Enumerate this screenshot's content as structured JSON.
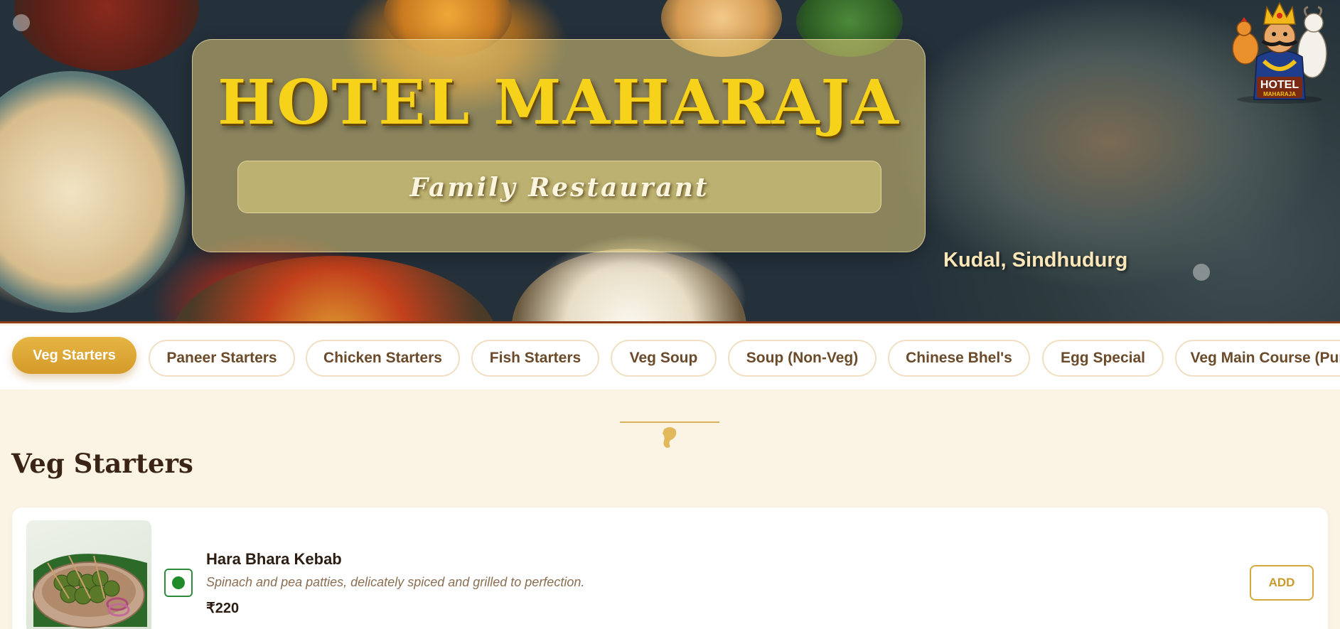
{
  "header": {
    "hotel_name": "HOTEL MAHARAJA",
    "tagline": "Family Restaurant",
    "location": "Kudal, Sindhudurg",
    "logo_text_main": "HOTEL",
    "logo_text_sub": "MAHARAJA"
  },
  "categories": [
    {
      "label": "Veg Starters",
      "active": true
    },
    {
      "label": "Paneer Starters",
      "active": false
    },
    {
      "label": "Chicken Starters",
      "active": false
    },
    {
      "label": "Fish Starters",
      "active": false
    },
    {
      "label": "Veg Soup",
      "active": false
    },
    {
      "label": "Soup (Non-Veg)",
      "active": false
    },
    {
      "label": "Chinese Bhel's",
      "active": false
    },
    {
      "label": "Egg Special",
      "active": false
    },
    {
      "label": "Veg Main Course (Pur",
      "active": false
    }
  ],
  "section": {
    "title": "Veg Starters"
  },
  "items": [
    {
      "name": "Hara Bhara Kebab",
      "description": "Spinach and pea patties, delicately spiced and grilled to perfection.",
      "price": "₹220",
      "type": "veg",
      "add_label": "ADD"
    }
  ],
  "colors": {
    "accent_gold": "#d49a2a",
    "hero_border": "#8c3b12",
    "veg_green": "#1f8a2a",
    "background": "#fbf3e4"
  }
}
